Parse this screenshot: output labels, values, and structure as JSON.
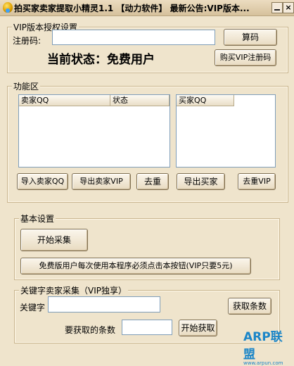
{
  "window": {
    "title": "拍买家卖家提取小精灵1.1 【动力软件】 最新公告:VIP版本...",
    "close_glyph": "×"
  },
  "vip_group": {
    "legend": "VIP版本授权设置",
    "reg_label": "注册码:",
    "reg_value": "",
    "calc_button": "算码",
    "status_text": "当前状态：免费用户",
    "buy_button": "购买VIP注册码"
  },
  "func_group": {
    "legend": "功能区",
    "left_list": {
      "columns": [
        "卖家QQ",
        "状态"
      ]
    },
    "right_list": {
      "columns": [
        "买家QQ"
      ]
    },
    "buttons": {
      "import_seller": "导入卖家QQ",
      "export_seller": "导出卖家VIP",
      "dedupe_left": "去重",
      "export_buyer": "导出买家",
      "dedupe_vip": "去重VIP"
    }
  },
  "basic_group": {
    "legend": "基本设置",
    "start_button": "开始采集",
    "free_notice_button": "免费版用户每次使用本程序必须点击本按钮(VIP只要5元)"
  },
  "keyword_group": {
    "legend": "关键字卖家采集（VIP独享）",
    "keyword_label": "关键字",
    "keyword_value": "",
    "get_count_button": "获取条数",
    "count_label": "要获取的条数",
    "count_value": "",
    "start_get_button": "开始获取"
  },
  "watermark": {
    "main": "ARP联盟",
    "sub": "www.arpun.com"
  }
}
